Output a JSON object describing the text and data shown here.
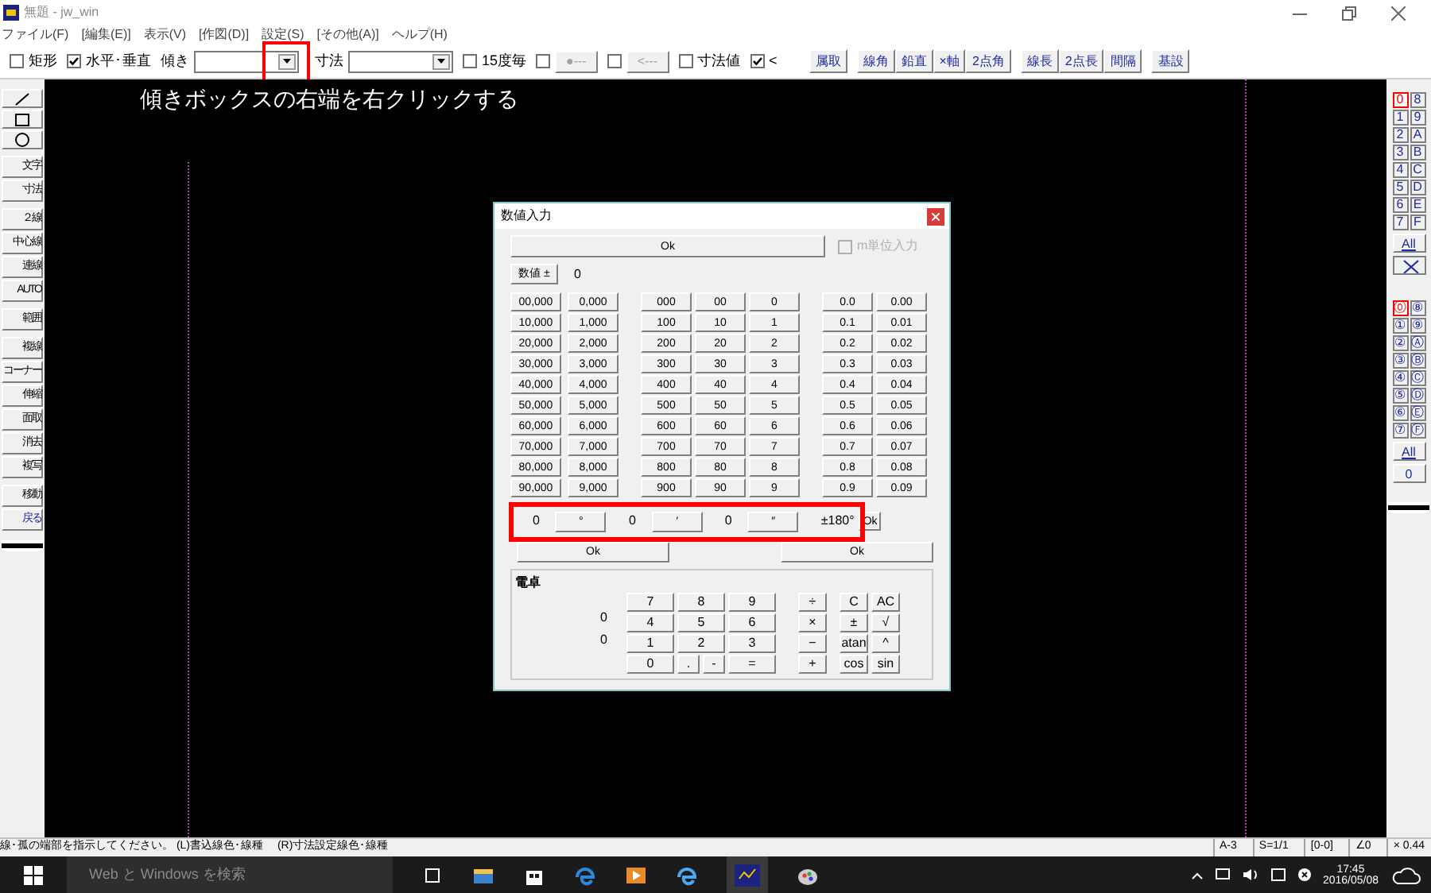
{
  "window": {
    "title": "無題 - jw_win"
  },
  "menu": [
    "ファイル(F)",
    "[編集(E)]",
    "表示(V)",
    "[作図(D)]",
    "設定(S)",
    "[その他(A)]",
    "ヘルプ(H)"
  ],
  "toolbar": [
    {
      "kind": "check",
      "label": "矩形",
      "checked": false
    },
    {
      "kind": "check",
      "label": "水平･垂直",
      "checked": true
    },
    {
      "kind": "combo",
      "label": "傾き",
      "highlighted": true
    },
    {
      "kind": "combo",
      "label": "寸法"
    },
    {
      "kind": "check",
      "label": "15度毎",
      "checked": false
    },
    {
      "kind": "checkbutton",
      "label": "●---",
      "checked": false
    },
    {
      "kind": "checkbutton",
      "label": "<---",
      "checked": false
    },
    {
      "kind": "check",
      "label": "寸法値",
      "checked": false
    },
    {
      "kind": "check",
      "label": "<",
      "checked": true
    }
  ],
  "tool_buttons": [
    [
      "属取"
    ],
    [
      "線角",
      "鉛直",
      "×軸",
      "2点角"
    ],
    [
      "線長",
      "2点長",
      "間隔"
    ],
    [
      "基設"
    ]
  ],
  "left_tools": [
    "文字",
    "寸法",
    "２線",
    "中心線",
    "連線",
    "AUTO",
    "範囲",
    "複線",
    "コーナー",
    "伸縮",
    "面取",
    "消去",
    "複写",
    "移動",
    "戻る"
  ],
  "layers": [
    {
      "label": "0",
      "selected": true
    },
    {
      "label": "8",
      "selected": false
    },
    {
      "label": "1",
      "selected": false
    },
    {
      "label": "9",
      "selected": false
    },
    {
      "label": "2",
      "selected": false
    },
    {
      "label": "A",
      "selected": false
    },
    {
      "label": "3",
      "selected": false
    },
    {
      "label": "B",
      "selected": false
    },
    {
      "label": "4",
      "selected": false
    },
    {
      "label": "C",
      "selected": false
    },
    {
      "label": "5",
      "selected": false
    },
    {
      "label": "D",
      "selected": false
    },
    {
      "label": "6",
      "selected": false
    },
    {
      "label": "E",
      "selected": false
    },
    {
      "label": "7",
      "selected": false
    },
    {
      "label": "F",
      "selected": false
    }
  ],
  "layers_all": "All",
  "layer_groups": [
    {
      "label": "⓪",
      "selected": true
    },
    {
      "label": "⑧",
      "selected": false
    },
    {
      "label": "①",
      "selected": false
    },
    {
      "label": "⑨",
      "selected": false
    },
    {
      "label": "②",
      "selected": false
    },
    {
      "label": "Ⓐ",
      "selected": false
    },
    {
      "label": "③",
      "selected": false
    },
    {
      "label": "Ⓑ",
      "selected": false
    },
    {
      "label": "④",
      "selected": false
    },
    {
      "label": "Ⓒ",
      "selected": false
    },
    {
      "label": "⑤",
      "selected": false
    },
    {
      "label": "Ⓓ",
      "selected": false
    },
    {
      "label": "⑥",
      "selected": false
    },
    {
      "label": "Ⓔ",
      "selected": false
    },
    {
      "label": "⑦",
      "selected": false
    },
    {
      "label": "Ⓕ",
      "selected": false
    }
  ],
  "layer_groups_all": "All",
  "layer_groups_value": "0",
  "canvas": {
    "instruction": "傾きボックスの右端を右クリックする"
  },
  "dialog": {
    "title": "数値入力",
    "ok": "Ok",
    "unit_option": {
      "label": "m単位入力",
      "checked": false,
      "disabled": true
    },
    "sign_button": "数値 ±",
    "value": "0",
    "keypad": [
      [
        "00,000",
        "0,000",
        "000",
        "00",
        "0",
        "0.0",
        "0.00"
      ],
      [
        "10,000",
        "1,000",
        "100",
        "10",
        "1",
        "0.1",
        "0.01"
      ],
      [
        "20,000",
        "2,000",
        "200",
        "20",
        "2",
        "0.2",
        "0.02"
      ],
      [
        "30,000",
        "3,000",
        "300",
        "30",
        "3",
        "0.3",
        "0.03"
      ],
      [
        "40,000",
        "4,000",
        "400",
        "40",
        "4",
        "0.4",
        "0.04"
      ],
      [
        "50,000",
        "5,000",
        "500",
        "50",
        "5",
        "0.5",
        "0.05"
      ],
      [
        "60,000",
        "6,000",
        "600",
        "60",
        "6",
        "0.6",
        "0.06"
      ],
      [
        "70,000",
        "7,000",
        "700",
        "70",
        "7",
        "0.7",
        "0.07"
      ],
      [
        "80,000",
        "8,000",
        "800",
        "80",
        "8",
        "0.8",
        "0.08"
      ],
      [
        "90,000",
        "9,000",
        "900",
        "90",
        "9",
        "0.9",
        "0.09"
      ]
    ],
    "angle": [
      {
        "value": "0",
        "unit": "°"
      },
      {
        "value": "0",
        "unit": "′"
      },
      {
        "value": "0",
        "unit": "″"
      }
    ],
    "angle_range": "±180°",
    "angle_ok": "Ok",
    "ok_buttons": [
      "Ok",
      "Ok"
    ],
    "calculator": {
      "title": "電卓",
      "display": [
        "0",
        "0"
      ],
      "keys": [
        [
          "7",
          "8",
          "9",
          "÷",
          "C",
          "AC"
        ],
        [
          "4",
          "5",
          "6",
          "×",
          "±",
          "√"
        ],
        [
          "1",
          "2",
          "3",
          "−",
          "atan",
          "^"
        ],
        [
          "0",
          ".",
          "-",
          "=",
          "+",
          "cos",
          "sin"
        ]
      ]
    }
  },
  "status_bar": {
    "message": "線･孤の端部を指示してください。 (L)書込線色･線種　 (R)寸法設定線色･線種",
    "fields": [
      "A-3",
      "S=1/1",
      "[0-0]",
      "∠0",
      "× 0.44"
    ]
  },
  "taskbar": {
    "search": "Web と Windows を検索",
    "time": "17:45",
    "date": "2016/05/08"
  }
}
